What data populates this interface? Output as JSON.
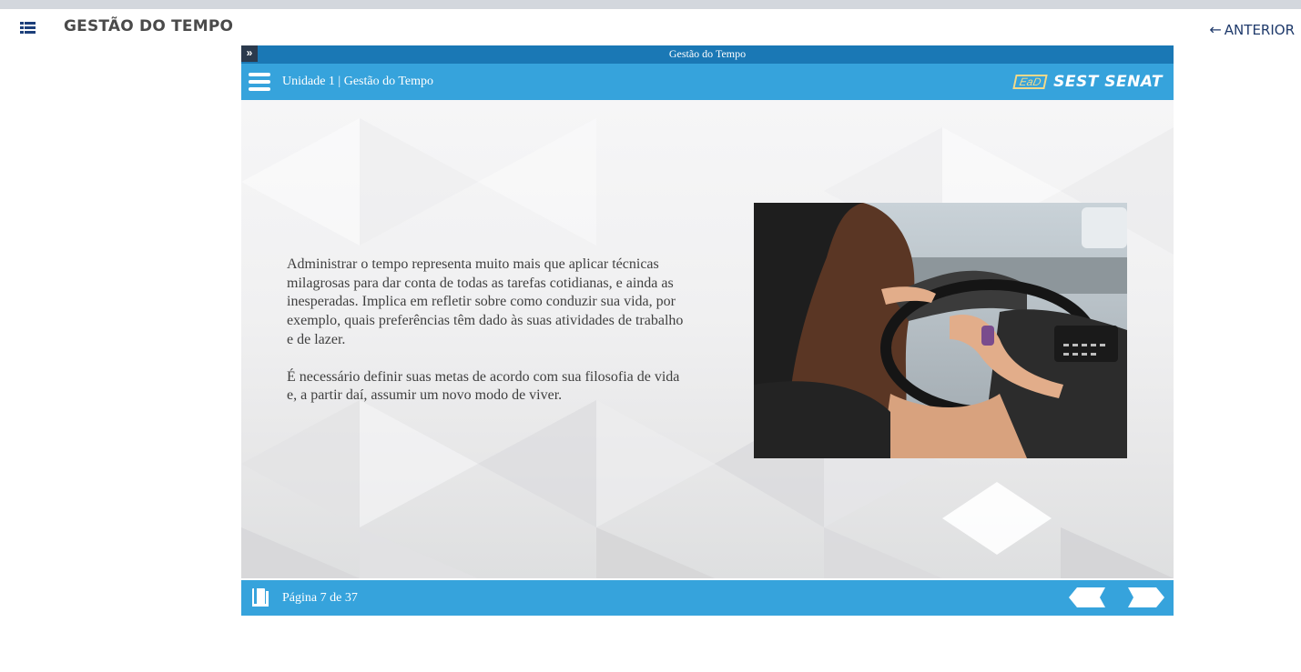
{
  "app": {
    "title": "GESTÃO DO TEMPO",
    "prev_label": "ANTERIOR",
    "prev_arrow": "←"
  },
  "player": {
    "window_caption": "Gestão do Tempo",
    "toggle_glyph": "»",
    "unit_label": "Unidade 1 | Gestão do Tempo",
    "logo": {
      "ead": "EaD",
      "brand": "SEST SENAT"
    },
    "content": {
      "paragraphs": [
        "Administrar o tempo representa muito mais que aplicar técnicas milagrosas para dar conta de todas as tarefas cotidianas, e ainda as inesperadas. Implica em refletir sobre como conduzir sua vida, por exemplo, quais preferências têm dado às suas atividades de trabalho e de lazer.",
        "É necessário definir suas metas de acordo com sua filosofia de vida e, a partir daí, assumir um novo modo de viver."
      ]
    },
    "footer": {
      "page_label": "Página 7 de 37",
      "current_page": 7,
      "total_pages": 37
    }
  },
  "colors": {
    "title_bar": "#1a78b5",
    "accent": "#36a3dc",
    "logo_ead": "#f2d98a",
    "nav_icon": "#1c3f7a"
  },
  "icons": {
    "app_menu": "list-menu-icon",
    "player_menu": "hamburger-icon",
    "footer": "book-icon",
    "prev": "prev-arrow-icon",
    "next": "next-arrow-icon"
  }
}
